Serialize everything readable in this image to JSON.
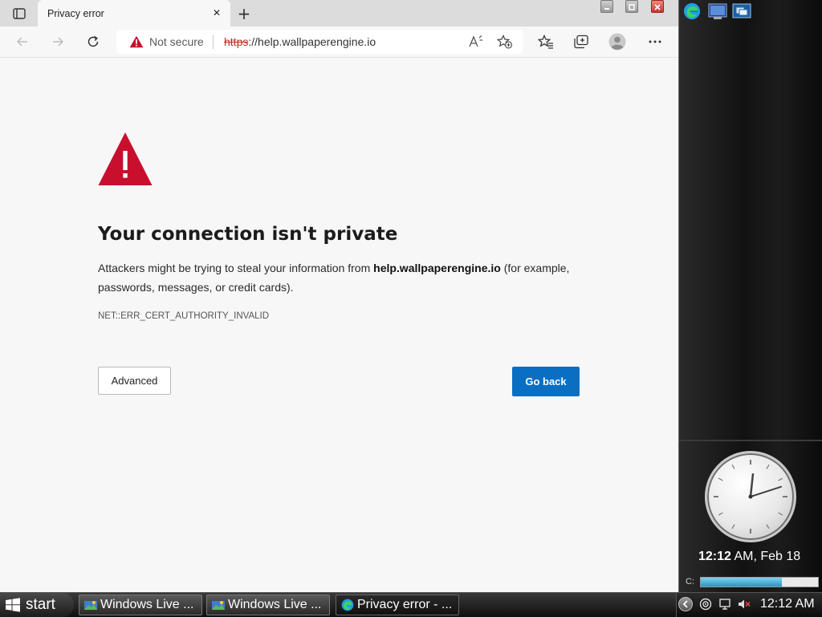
{
  "browser": {
    "tab": {
      "title": "Privacy error",
      "close_glyph": "✕"
    },
    "newtab_glyph": "+",
    "address": {
      "security_label": "Not secure",
      "url_protocol": "https",
      "url_rest": "://help.wallpaperengine.io"
    },
    "page": {
      "headline": "Your connection isn't private",
      "desc_before": "Attackers might be trying to steal your information from ",
      "desc_host": "help.wallpaperengine.io",
      "desc_after": " (for example, passwords, messages, or credit cards).",
      "error_code": "NET::ERR_CERT_AUTHORITY_INVALID",
      "advanced_label": "Advanced",
      "goback_label": "Go back"
    },
    "icons": [
      "tab-actions-icon",
      "back-icon",
      "forward-icon",
      "refresh-icon",
      "warning-icon",
      "read-aloud-icon",
      "add-favorite-icon",
      "favorites-icon",
      "collections-icon",
      "profile-icon",
      "more-icon"
    ],
    "colors": {
      "warning_red": "#c8102e",
      "primary_blue": "#0a6fc2",
      "insecure_red": "#c42b1c"
    }
  },
  "sidebar": {
    "clock": {
      "time": "12:12",
      "rest": " AM, Feb 18",
      "hour": 12,
      "minute": 12
    },
    "drive": {
      "label": "C:",
      "used_fraction": 0.69
    }
  },
  "taskbar": {
    "start_label": "start",
    "buttons": [
      {
        "label": "Windows Live ..."
      },
      {
        "label": "Windows Live ..."
      },
      {
        "label": "Privacy error - ..."
      }
    ],
    "tray_time": "12:12 AM"
  }
}
